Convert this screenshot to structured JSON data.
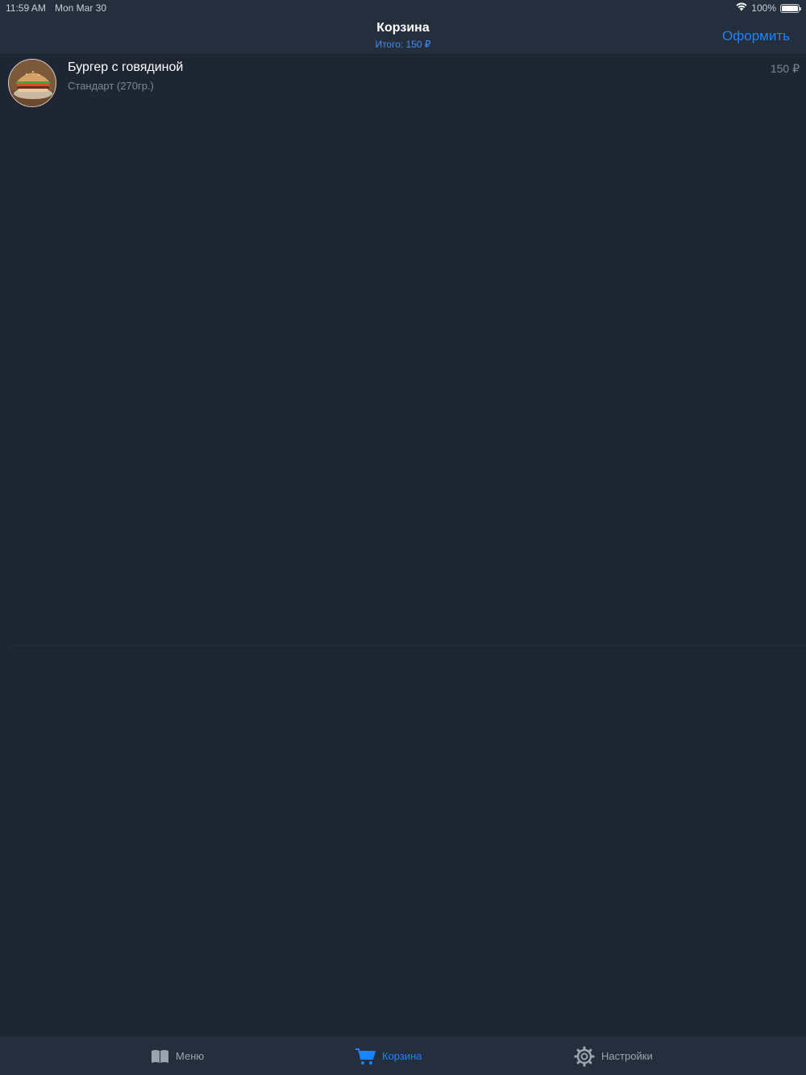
{
  "status_bar": {
    "time": "11:59 AM",
    "date": "Mon Mar 30",
    "battery": "100%",
    "wifi_icon": "wifi-icon",
    "battery_icon": "battery-icon"
  },
  "nav": {
    "title": "Корзина",
    "subtitle": "Итого: 150 ₽",
    "action_label": "Оформить"
  },
  "cart": {
    "items": [
      {
        "name": "Бургер с говядиной",
        "variant": "Стандарт (270гр.)",
        "price": "150 ₽",
        "image_icon": "burger-photo"
      }
    ]
  },
  "tabs": [
    {
      "label": "Меню",
      "icon": "book-icon",
      "active": false
    },
    {
      "label": "Корзина",
      "icon": "cart-icon",
      "active": true
    },
    {
      "label": "Настройки",
      "icon": "gear-icon",
      "active": false
    }
  ],
  "colors": {
    "background": "#1e2633",
    "bar": "#252e3c",
    "accent": "#1a84ff",
    "secondary_text": "#7b8595"
  }
}
